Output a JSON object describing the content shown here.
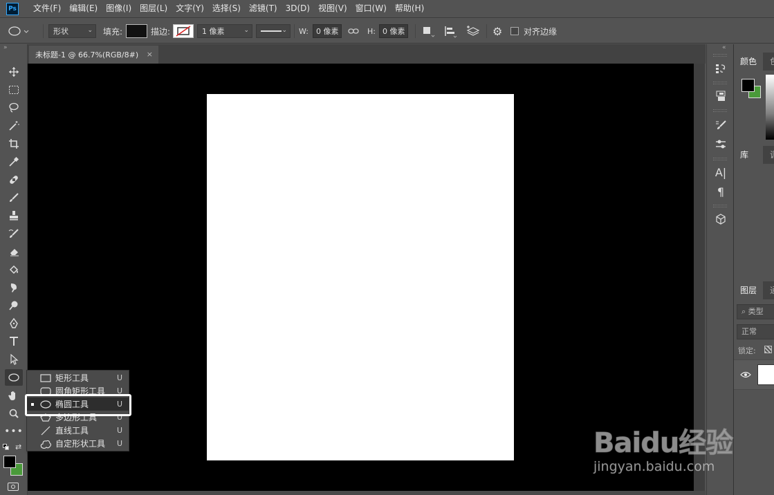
{
  "app": {
    "logo_text": "Ps"
  },
  "menu": [
    "文件(F)",
    "编辑(E)",
    "图像(I)",
    "图层(L)",
    "文字(Y)",
    "选择(S)",
    "滤镜(T)",
    "3D(D)",
    "视图(V)",
    "窗口(W)",
    "帮助(H)"
  ],
  "options": {
    "mode_value": "形状",
    "fill_label": "填充:",
    "stroke_label": "描边:",
    "stroke_width": "1 像素",
    "w_label": "W:",
    "w_value": "0 像素",
    "h_label": "H:",
    "h_value": "0 像素",
    "align_edges_label": "对齐边缘",
    "align_edges_checked": false
  },
  "document": {
    "tab_title": "未标题-1 @ 66.7%(RGB/8#)",
    "close_glyph": "×"
  },
  "tools": [
    "move-tool",
    "marquee-tool",
    "lasso-tool",
    "magic-wand-tool",
    "crop-tool",
    "eyedropper-tool",
    "healing-brush-tool",
    "brush-tool",
    "clone-stamp-tool",
    "history-brush-tool",
    "eraser-tool",
    "paint-bucket-tool",
    "smudge-tool",
    "dodge-tool",
    "pen-tool",
    "type-tool",
    "path-selection-tool",
    "ellipse-tool",
    "hand-tool",
    "zoom-tool",
    "more-tools"
  ],
  "flyout": {
    "items": [
      {
        "label": "矩形工具",
        "key": "U",
        "icon": "rectangle-icon"
      },
      {
        "label": "圆角矩形工具",
        "key": "U",
        "icon": "rounded-rectangle-icon"
      },
      {
        "label": "椭圆工具",
        "key": "U",
        "icon": "ellipse-icon",
        "selected": true
      },
      {
        "label": "多边形工具",
        "key": "U",
        "icon": "polygon-icon"
      },
      {
        "label": "直线工具",
        "key": "U",
        "icon": "line-icon"
      },
      {
        "label": "自定形状工具",
        "key": "U",
        "icon": "custom-shape-icon"
      }
    ]
  },
  "colors": {
    "foreground": "#000000",
    "background": "#4a9a3a",
    "canvas_bg": "#000000",
    "artboard": "#ffffff"
  },
  "panels": {
    "color_tab": "颜色",
    "color_tab2": "色",
    "library_tab": "库",
    "library_tab2": "调",
    "layers_tab": "图层",
    "layers_tab2": "通",
    "search_kind": "类型",
    "blend_mode": "正常",
    "lock_label": "锁定:"
  },
  "watermark": {
    "logo": "Baidu经验",
    "url": "jingyan.baidu.com"
  }
}
